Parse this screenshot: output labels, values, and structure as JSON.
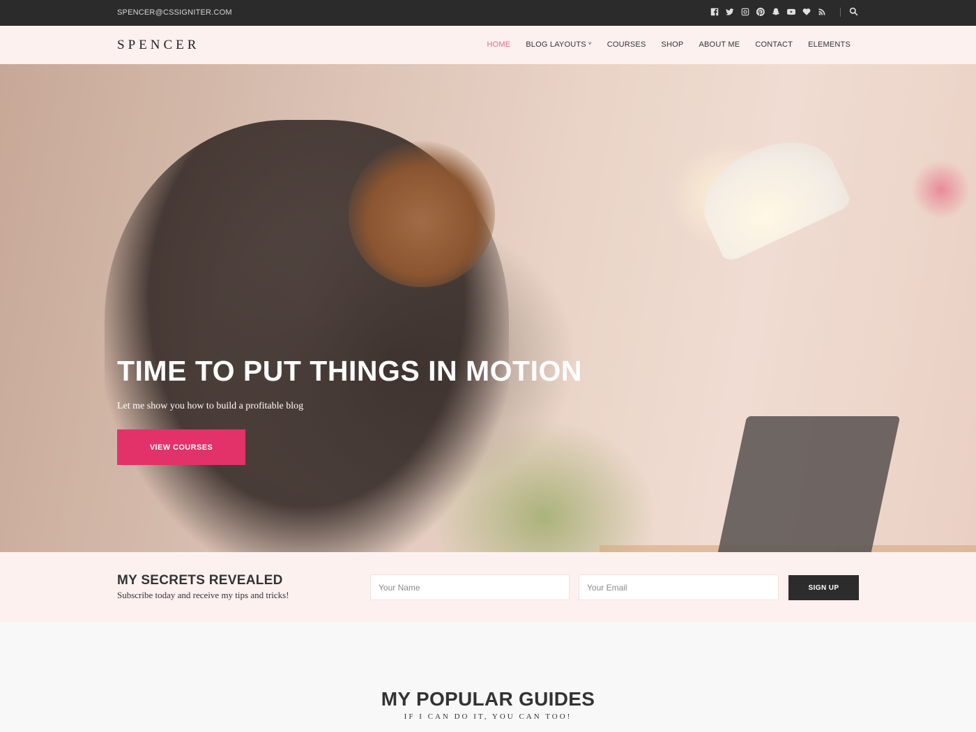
{
  "topbar": {
    "email": "SPENCER@CSSIGNITER.COM",
    "social_icons": [
      "facebook-icon",
      "twitter-icon",
      "instagram-icon",
      "pinterest-icon",
      "snapchat-icon",
      "youtube-icon",
      "heart-icon",
      "rss-icon"
    ],
    "search_icon": "search-icon"
  },
  "header": {
    "logo": "SPENCER",
    "nav": [
      {
        "label": "HOME",
        "active": true
      },
      {
        "label": "BLOG LAYOUTS",
        "has_dropdown": true
      },
      {
        "label": "COURSES"
      },
      {
        "label": "SHOP"
      },
      {
        "label": "ABOUT ME"
      },
      {
        "label": "CONTACT"
      },
      {
        "label": "ELEMENTS"
      }
    ],
    "dropdown_caret": "˅"
  },
  "hero": {
    "title": "TIME TO PUT THINGS IN MOTION",
    "subtitle": "Let me show you how to build a profitable blog",
    "button_label": "VIEW COURSES"
  },
  "subscribe": {
    "title": "MY SECRETS REVEALED",
    "text": "Subscribe today and receive my tips and tricks!",
    "name_placeholder": "Your Name",
    "email_placeholder": "Your Email",
    "button_label": "SIGN UP"
  },
  "guides": {
    "title": "MY POPULAR GUIDES",
    "subtitle": "IF I CAN DO IT, YOU CAN TOO!"
  },
  "colors": {
    "accent": "#e23269",
    "active_nav": "#e26a88",
    "topbar_bg": "#2b2b2b",
    "header_bg": "#fdf1ef",
    "button_dark": "#2c2c2c"
  }
}
